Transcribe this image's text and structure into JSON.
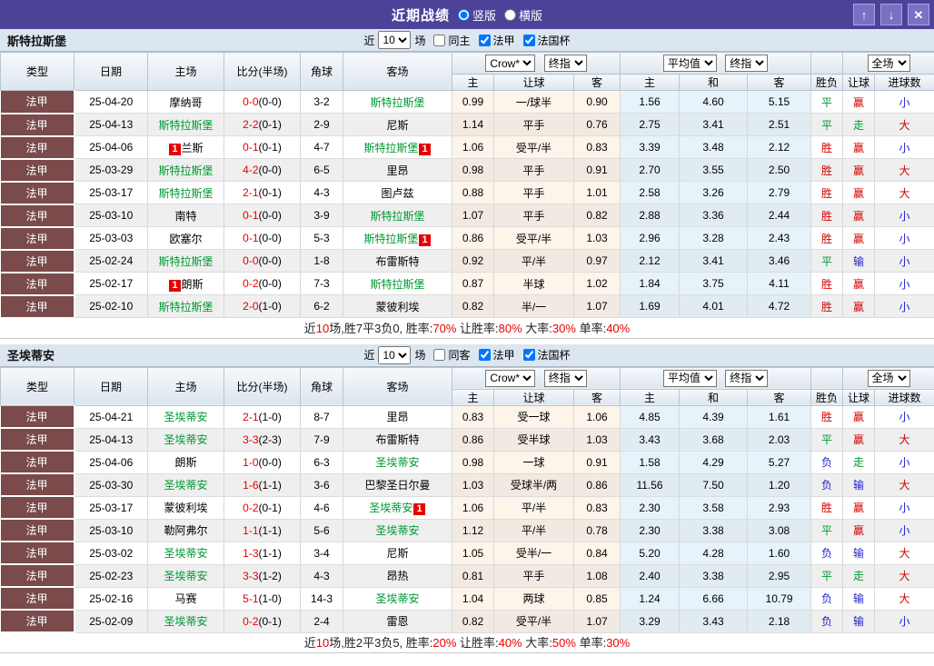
{
  "titlebar": {
    "title": "近期战绩",
    "layout_options": [
      {
        "label": "竖版",
        "selected": true
      },
      {
        "label": "横版",
        "selected": false
      }
    ],
    "buttons": {
      "up": "↑",
      "down": "↓",
      "close": "✕"
    }
  },
  "table_header": {
    "cols": [
      "类型",
      "日期",
      "主场",
      "比分(半场)",
      "角球",
      "客场"
    ],
    "sub_cols": [
      "主",
      "让球",
      "客",
      "主",
      "和",
      "客",
      "胜负",
      "让球",
      "进球数"
    ],
    "selects": {
      "odds_source": "Crow*",
      "odds_time": "终指",
      "euro_source": "平均值",
      "euro_time": "终指",
      "scope": "全场"
    }
  },
  "status_colors": {
    "胜": "#d40000",
    "平": "#009933",
    "负": "#2222cc",
    "赢": "#d40000",
    "走": "#009933",
    "输": "#2222cc",
    "大": "#d40000",
    "小": "#2222cc"
  },
  "sections": [
    {
      "team": "斯特拉斯堡",
      "filter": {
        "prefix": "近",
        "count": "10",
        "suffix": "场",
        "same_venue_label": "同主",
        "same_venue_checked": false,
        "league_label": "法甲",
        "league_checked": true,
        "cup_label": "法国杯",
        "cup_checked": true
      },
      "rows": [
        {
          "league": "法甲",
          "date": "25-04-20",
          "home": {
            "name": "摩纳哥"
          },
          "score": "0-0",
          "half": "(0-0)",
          "corners": "3-2",
          "away": {
            "name": "斯特拉斯堡",
            "green": true
          },
          "odds": [
            "0.99",
            "一/球半",
            "0.90"
          ],
          "avg": [
            "1.56",
            "4.60",
            "5.15"
          ],
          "outcome": "平",
          "handicap_result": "赢",
          "goals": "小"
        },
        {
          "league": "法甲",
          "date": "25-04-13",
          "home": {
            "name": "斯特拉斯堡",
            "green": true
          },
          "score": "2-2",
          "half": "(0-1)",
          "corners": "2-9",
          "away": {
            "name": "尼斯"
          },
          "odds": [
            "1.14",
            "平手",
            "0.76"
          ],
          "avg": [
            "2.75",
            "3.41",
            "2.51"
          ],
          "outcome": "平",
          "handicap_result": "走",
          "goals": "大"
        },
        {
          "league": "法甲",
          "date": "25-04-06",
          "home": {
            "name": "兰斯",
            "badge": "1",
            "badge_side": "left"
          },
          "score": "0-1",
          "half": "(0-1)",
          "corners": "4-7",
          "away": {
            "name": "斯特拉斯堡",
            "green": true,
            "badge": "1",
            "badge_side": "right"
          },
          "odds": [
            "1.06",
            "受平/半",
            "0.83"
          ],
          "avg": [
            "3.39",
            "3.48",
            "2.12"
          ],
          "outcome": "胜",
          "handicap_result": "赢",
          "goals": "小"
        },
        {
          "league": "法甲",
          "date": "25-03-29",
          "home": {
            "name": "斯特拉斯堡",
            "green": true
          },
          "score": "4-2",
          "half": "(0-0)",
          "corners": "6-5",
          "away": {
            "name": "里昂"
          },
          "odds": [
            "0.98",
            "平手",
            "0.91"
          ],
          "avg": [
            "2.70",
            "3.55",
            "2.50"
          ],
          "outcome": "胜",
          "handicap_result": "赢",
          "goals": "大"
        },
        {
          "league": "法甲",
          "date": "25-03-17",
          "home": {
            "name": "斯特拉斯堡",
            "green": true
          },
          "score": "2-1",
          "half": "(0-1)",
          "corners": "4-3",
          "away": {
            "name": "图卢兹"
          },
          "odds": [
            "0.88",
            "平手",
            "1.01"
          ],
          "avg": [
            "2.58",
            "3.26",
            "2.79"
          ],
          "outcome": "胜",
          "handicap_result": "赢",
          "goals": "大"
        },
        {
          "league": "法甲",
          "date": "25-03-10",
          "home": {
            "name": "南特"
          },
          "score": "0-1",
          "half": "(0-0)",
          "corners": "3-9",
          "away": {
            "name": "斯特拉斯堡",
            "green": true
          },
          "odds": [
            "1.07",
            "平手",
            "0.82"
          ],
          "avg": [
            "2.88",
            "3.36",
            "2.44"
          ],
          "outcome": "胜",
          "handicap_result": "赢",
          "goals": "小"
        },
        {
          "league": "法甲",
          "date": "25-03-03",
          "home": {
            "name": "欧塞尔"
          },
          "score": "0-1",
          "half": "(0-0)",
          "corners": "5-3",
          "away": {
            "name": "斯特拉斯堡",
            "green": true,
            "badge": "1",
            "badge_side": "right"
          },
          "odds": [
            "0.86",
            "受平/半",
            "1.03"
          ],
          "avg": [
            "2.96",
            "3.28",
            "2.43"
          ],
          "outcome": "胜",
          "handicap_result": "赢",
          "goals": "小"
        },
        {
          "league": "法甲",
          "date": "25-02-24",
          "home": {
            "name": "斯特拉斯堡",
            "green": true
          },
          "score": "0-0",
          "half": "(0-0)",
          "corners": "1-8",
          "away": {
            "name": "布雷斯特"
          },
          "odds": [
            "0.92",
            "平/半",
            "0.97"
          ],
          "avg": [
            "2.12",
            "3.41",
            "3.46"
          ],
          "outcome": "平",
          "handicap_result": "输",
          "goals": "小"
        },
        {
          "league": "法甲",
          "date": "25-02-17",
          "home": {
            "name": "朗斯",
            "badge": "1",
            "badge_side": "left"
          },
          "score": "0-2",
          "half": "(0-0)",
          "corners": "7-3",
          "away": {
            "name": "斯特拉斯堡",
            "green": true
          },
          "odds": [
            "0.87",
            "半球",
            "1.02"
          ],
          "avg": [
            "1.84",
            "3.75",
            "4.11"
          ],
          "outcome": "胜",
          "handicap_result": "赢",
          "goals": "小"
        },
        {
          "league": "法甲",
          "date": "25-02-10",
          "home": {
            "name": "斯特拉斯堡",
            "green": true
          },
          "score": "2-0",
          "half": "(1-0)",
          "corners": "6-2",
          "away": {
            "name": "蒙彼利埃"
          },
          "odds": [
            "0.82",
            "半/一",
            "1.07"
          ],
          "avg": [
            "1.69",
            "4.01",
            "4.72"
          ],
          "outcome": "胜",
          "handicap_result": "赢",
          "goals": "小"
        }
      ],
      "summary": [
        [
          "近",
          "blk"
        ],
        [
          "10",
          "red"
        ],
        [
          "场,胜7平3负0, 胜率:",
          "blk"
        ],
        [
          "70%",
          "red"
        ],
        [
          " 让胜率:",
          "blk"
        ],
        [
          "80%",
          "red"
        ],
        [
          " 大率:",
          "blk"
        ],
        [
          "30%",
          "red"
        ],
        [
          " 单率:",
          "blk"
        ],
        [
          "40%",
          "red"
        ]
      ]
    },
    {
      "team": "圣埃蒂安",
      "filter": {
        "prefix": "近",
        "count": "10",
        "suffix": "场",
        "same_venue_label": "同客",
        "same_venue_checked": false,
        "league_label": "法甲",
        "league_checked": true,
        "cup_label": "法国杯",
        "cup_checked": true
      },
      "rows": [
        {
          "league": "法甲",
          "date": "25-04-21",
          "home": {
            "name": "圣埃蒂安",
            "green": true
          },
          "score": "2-1",
          "half": "(1-0)",
          "corners": "8-7",
          "away": {
            "name": "里昂"
          },
          "odds": [
            "0.83",
            "受一球",
            "1.06"
          ],
          "avg": [
            "4.85",
            "4.39",
            "1.61"
          ],
          "outcome": "胜",
          "handicap_result": "赢",
          "goals": "小"
        },
        {
          "league": "法甲",
          "date": "25-04-13",
          "home": {
            "name": "圣埃蒂安",
            "green": true
          },
          "score": "3-3",
          "half": "(2-3)",
          "corners": "7-9",
          "away": {
            "name": "布雷斯特"
          },
          "odds": [
            "0.86",
            "受半球",
            "1.03"
          ],
          "avg": [
            "3.43",
            "3.68",
            "2.03"
          ],
          "outcome": "平",
          "handicap_result": "赢",
          "goals": "大"
        },
        {
          "league": "法甲",
          "date": "25-04-06",
          "home": {
            "name": "朗斯"
          },
          "score": "1-0",
          "half": "(0-0)",
          "corners": "6-3",
          "away": {
            "name": "圣埃蒂安",
            "green": true
          },
          "odds": [
            "0.98",
            "一球",
            "0.91"
          ],
          "avg": [
            "1.58",
            "4.29",
            "5.27"
          ],
          "outcome": "负",
          "handicap_result": "走",
          "goals": "小"
        },
        {
          "league": "法甲",
          "date": "25-03-30",
          "home": {
            "name": "圣埃蒂安",
            "green": true
          },
          "score": "1-6",
          "half": "(1-1)",
          "corners": "3-6",
          "away": {
            "name": "巴黎圣日尔曼"
          },
          "odds": [
            "1.03",
            "受球半/两",
            "0.86"
          ],
          "avg": [
            "11.56",
            "7.50",
            "1.20"
          ],
          "outcome": "负",
          "handicap_result": "输",
          "goals": "大"
        },
        {
          "league": "法甲",
          "date": "25-03-17",
          "home": {
            "name": "蒙彼利埃"
          },
          "score": "0-2",
          "half": "(0-1)",
          "corners": "4-6",
          "away": {
            "name": "圣埃蒂安",
            "green": true,
            "badge": "1",
            "badge_side": "right"
          },
          "odds": [
            "1.06",
            "平/半",
            "0.83"
          ],
          "avg": [
            "2.30",
            "3.58",
            "2.93"
          ],
          "outcome": "胜",
          "handicap_result": "赢",
          "goals": "小"
        },
        {
          "league": "法甲",
          "date": "25-03-10",
          "home": {
            "name": "勒阿弗尔"
          },
          "score": "1-1",
          "half": "(1-1)",
          "corners": "5-6",
          "away": {
            "name": "圣埃蒂安",
            "green": true
          },
          "odds": [
            "1.12",
            "平/半",
            "0.78"
          ],
          "avg": [
            "2.30",
            "3.38",
            "3.08"
          ],
          "outcome": "平",
          "handicap_result": "赢",
          "goals": "小"
        },
        {
          "league": "法甲",
          "date": "25-03-02",
          "home": {
            "name": "圣埃蒂安",
            "green": true
          },
          "score": "1-3",
          "half": "(1-1)",
          "corners": "3-4",
          "away": {
            "name": "尼斯"
          },
          "odds": [
            "1.05",
            "受半/一",
            "0.84"
          ],
          "avg": [
            "5.20",
            "4.28",
            "1.60"
          ],
          "outcome": "负",
          "handicap_result": "输",
          "goals": "大"
        },
        {
          "league": "法甲",
          "date": "25-02-23",
          "home": {
            "name": "圣埃蒂安",
            "green": true
          },
          "score": "3-3",
          "half": "(1-2)",
          "corners": "4-3",
          "away": {
            "name": "昂热"
          },
          "odds": [
            "0.81",
            "平手",
            "1.08"
          ],
          "avg": [
            "2.40",
            "3.38",
            "2.95"
          ],
          "outcome": "平",
          "handicap_result": "走",
          "goals": "大"
        },
        {
          "league": "法甲",
          "date": "25-02-16",
          "home": {
            "name": "马赛"
          },
          "score": "5-1",
          "half": "(1-0)",
          "corners": "14-3",
          "away": {
            "name": "圣埃蒂安",
            "green": true
          },
          "odds": [
            "1.04",
            "两球",
            "0.85"
          ],
          "avg": [
            "1.24",
            "6.66",
            "10.79"
          ],
          "outcome": "负",
          "handicap_result": "输",
          "goals": "大"
        },
        {
          "league": "法甲",
          "date": "25-02-09",
          "home": {
            "name": "圣埃蒂安",
            "green": true
          },
          "score": "0-2",
          "half": "(0-1)",
          "corners": "2-4",
          "away": {
            "name": "雷恩"
          },
          "odds": [
            "0.82",
            "受平/半",
            "1.07"
          ],
          "avg": [
            "3.29",
            "3.43",
            "2.18"
          ],
          "outcome": "负",
          "handicap_result": "输",
          "goals": "小"
        }
      ],
      "summary": [
        [
          "近",
          "blk"
        ],
        [
          "10",
          "red"
        ],
        [
          "场,胜2平3负5, 胜率:",
          "blk"
        ],
        [
          "20%",
          "red"
        ],
        [
          " 让胜率:",
          "blk"
        ],
        [
          "40%",
          "red"
        ],
        [
          " 大率:",
          "blk"
        ],
        [
          "50%",
          "red"
        ],
        [
          " 单率:",
          "blk"
        ],
        [
          "30%",
          "red"
        ]
      ]
    }
  ]
}
